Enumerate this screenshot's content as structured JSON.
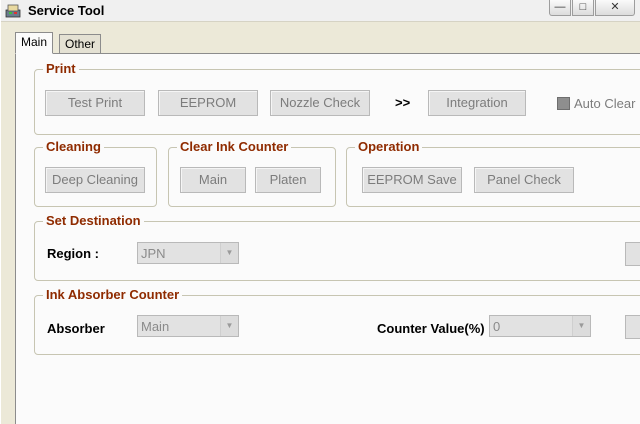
{
  "window": {
    "title": "Service Tool",
    "minimize": "—",
    "maximize": "□",
    "close": "✕"
  },
  "tabs": [
    {
      "label": "Main",
      "active": true
    },
    {
      "label": "Other",
      "active": false
    }
  ],
  "print": {
    "title": "Print",
    "test_print": "Test Print",
    "eeprom": "EEPROM",
    "nozzle_check": "Nozzle Check",
    "arrows": ">>",
    "integration": "Integration",
    "auto_clear": "Auto Clear"
  },
  "cleaning": {
    "title": "Cleaning",
    "deep_cleaning": "Deep Cleaning"
  },
  "clear_ink_counter": {
    "title": "Clear Ink Counter",
    "main": "Main",
    "platen": "Platen"
  },
  "operation": {
    "title": "Operation",
    "eeprom_save": "EEPROM Save",
    "panel_check": "Panel Check"
  },
  "set_destination": {
    "title": "Set Destination",
    "region_label": "Region :",
    "region_value": "JPN"
  },
  "ink_absorber": {
    "title": "Ink Absorber Counter",
    "absorber_label": "Absorber",
    "absorber_value": "Main",
    "counter_label": "Counter Value(%)",
    "counter_value": "0"
  },
  "colors": {
    "group_title": "#8f2b00",
    "disabled_text": "#7c7c7c",
    "panel_bg": "#fbfbfb"
  }
}
